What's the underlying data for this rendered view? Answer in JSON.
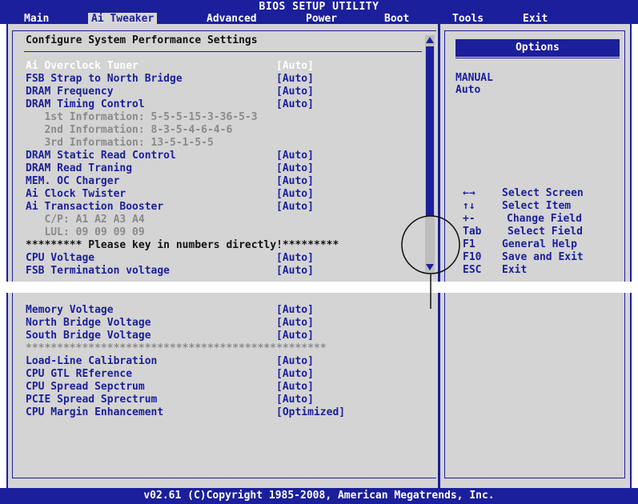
{
  "title": "BIOS SETUP UTILITY",
  "menu": [
    "Main",
    "Ai Tweaker",
    "Advanced",
    "Power",
    "Boot",
    "Tools",
    "Exit"
  ],
  "left": {
    "heading": "Configure System Performance Settings",
    "top_items": [
      {
        "label": "Ai Overclock Tuner",
        "value": "[Auto]",
        "style": "white"
      },
      {
        "label": "FSB Strap to North Bridge",
        "value": "[Auto]",
        "style": "blue"
      },
      {
        "label": "DRAM Frequency",
        "value": "[Auto]",
        "style": "blue"
      },
      {
        "label": "DRAM Timing Control",
        "value": "[Auto]",
        "style": "blue"
      },
      {
        "label": "   1st Information: 5-5-5-15-3-36-5-3",
        "value": "",
        "style": "gray"
      },
      {
        "label": "   2nd Information: 8-3-5-4-6-4-6",
        "value": "",
        "style": "gray"
      },
      {
        "label": "   3rd Information: 13-5-1-5-5",
        "value": "",
        "style": "gray"
      },
      {
        "label": "DRAM Static Read Control",
        "value": "[Auto]",
        "style": "blue"
      },
      {
        "label": "DRAM Read Traning",
        "value": "[Auto]",
        "style": "blue"
      },
      {
        "label": "MEM. OC Charger",
        "value": "[Auto]",
        "style": "blue"
      },
      {
        "label": "Ai Clock Twister",
        "value": "[Auto]",
        "style": "blue"
      },
      {
        "label": "Ai Transaction Booster",
        "value": "[Auto]",
        "style": "blue"
      },
      {
        "label": "   C/P: A1 A2 A3 A4",
        "value": "",
        "style": "gray"
      },
      {
        "label": "   LUL: 09 09 09 09",
        "value": "",
        "style": "gray"
      },
      {
        "label": "********* Please key in numbers directly!*********",
        "value": "",
        "style": "black"
      },
      {
        "label": "CPU Voltage",
        "value": "[Auto]",
        "style": "blue"
      },
      {
        "label": "FSB Termination voltage",
        "value": "[Auto]",
        "style": "blue"
      }
    ],
    "bottom_items": [
      {
        "label": "Memory Voltage",
        "value": "[Auto]",
        "style": "blue"
      },
      {
        "label": "North Bridge Voltage",
        "value": "[Auto]",
        "style": "blue"
      },
      {
        "label": "South Bridge Voltage",
        "value": "[Auto]",
        "style": "blue"
      },
      {
        "label": "************************************************",
        "value": "",
        "style": "gray"
      },
      {
        "label": "Load-Line Calibration",
        "value": "[Auto]",
        "style": "blue"
      },
      {
        "label": "CPU GTL REference",
        "value": "[Auto]",
        "style": "blue"
      },
      {
        "label": "CPU Spread Sepctrum",
        "value": "[Auto]",
        "style": "blue"
      },
      {
        "label": "PCIE Spread Sprectrum",
        "value": "[Auto]",
        "style": "blue"
      },
      {
        "label": "CPU Margin Enhancement",
        "value": "[Optimized]",
        "style": "blue"
      }
    ]
  },
  "right": {
    "options_title": "Options",
    "options": [
      "MANUAL",
      "Auto"
    ],
    "legend": [
      {
        "key": "←→",
        "desc": "Select Screen"
      },
      {
        "key": "↑↓",
        "desc": "Select Item"
      },
      {
        "key": "+-",
        "desc": "Change Field"
      },
      {
        "key": "Tab",
        "desc": "Select Field"
      },
      {
        "key": "F1",
        "desc": "General Help"
      },
      {
        "key": "F10",
        "desc": "Save and Exit"
      },
      {
        "key": "ESC",
        "desc": "Exit"
      }
    ]
  },
  "footer": "v02.61 (C)Copyright 1985-2008, American Megatrends, Inc.",
  "colors": {
    "bios_blue": "#1b1f9b",
    "panel_gray": "#d4d4d4"
  }
}
